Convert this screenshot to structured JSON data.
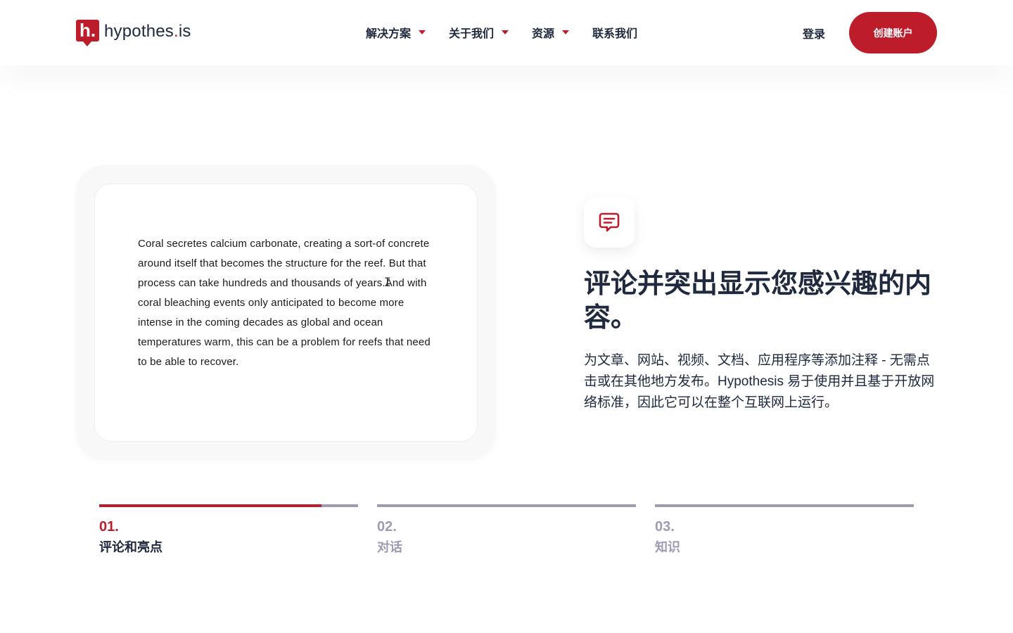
{
  "header": {
    "logo_text": "hypothes",
    "logo_dot": ".",
    "logo_suffix": "is",
    "logo_mark": "h.",
    "nav": [
      {
        "label": "解决方案",
        "has_dropdown": true
      },
      {
        "label": "关于我们",
        "has_dropdown": true
      },
      {
        "label": "资源",
        "has_dropdown": true
      },
      {
        "label": "联系我们",
        "has_dropdown": false
      }
    ],
    "login": "登录",
    "signup": "创建账户"
  },
  "demo": {
    "text_before_cursor": "Coral secretes calcium carbonate, creating a sort-of concrete around itself that becomes the structure for the reef. But that process can take hundreds and thousands of years.",
    "text_after_cursor": "And with coral bleaching events only anticipated to become more intense in the coming decades as global and ocean temperatures warm, this can be a problem for reefs that need to be able to recover.",
    "cursor_glyph": "I"
  },
  "feature": {
    "icon": "comment-icon",
    "title": "评论并突出显示您感兴趣的内容。",
    "description": "为文章、网站、视频、文档、应用程序等添加注释 - 无需点击或在其他地方发布。Hypothesis 易于使用并且基于开放网络标准，因此它可以在整个互联网上运行。"
  },
  "steps": [
    {
      "number": "01.",
      "label": "评论和亮点",
      "active": true,
      "progress": 0.86
    },
    {
      "number": "02.",
      "label": "对话",
      "active": false,
      "progress": 0
    },
    {
      "number": "03.",
      "label": "知识",
      "active": false,
      "progress": 0
    }
  ],
  "colors": {
    "brand_red": "#BD1C2B",
    "text_dark": "#202A3E",
    "muted": "#9E9BB2"
  }
}
